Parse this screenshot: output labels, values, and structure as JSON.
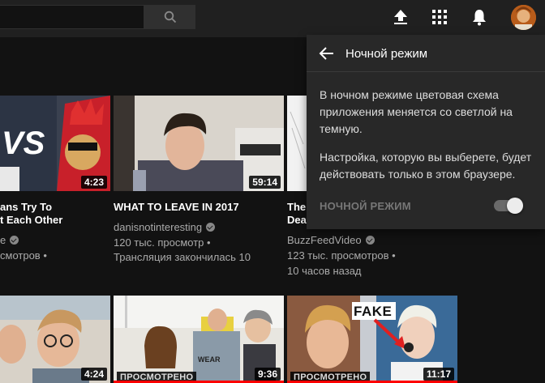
{
  "topbar": {
    "search_placeholder": "",
    "icons": [
      "search-icon",
      "upload-icon",
      "apps-icon",
      "notifications-icon",
      "avatar"
    ]
  },
  "videos": [
    {
      "title_line1": "ans Try To",
      "title_line2": "t Each Other",
      "channel": "e",
      "verified": true,
      "views": "смотров •",
      "age": "",
      "duration": "4:23"
    },
    {
      "title_line1": "WHAT TO LEAVE IN 2017",
      "title_line2": "",
      "channel": "danisnotinteresting",
      "verified": true,
      "views": "120 тыс. просмотр •",
      "age": "Трансляция закончилась 10",
      "duration": "59:14"
    },
    {
      "title_line1": "The",
      "title_line2": "Dea",
      "channel": "BuzzFeedVideo",
      "verified": true,
      "views": "123 тыс. просмотров •",
      "age": "10 часов назад",
      "duration": ""
    },
    {
      "title_line1": "",
      "title_line2": "",
      "channel": "",
      "verified": false,
      "views": "",
      "age": "",
      "duration": "4:24",
      "watched": ""
    },
    {
      "title_line1": "",
      "title_line2": "",
      "channel": "",
      "verified": false,
      "views": "",
      "age": "",
      "duration": "9:36",
      "watched": "ПРОСМОТРЕНО"
    },
    {
      "title_line1": "",
      "title_line2": "",
      "channel": "",
      "verified": false,
      "views": "",
      "age": "",
      "duration": "11:17",
      "watched": "ПРОСМОТРЕНО",
      "overlay": "FAKE"
    }
  ],
  "popup": {
    "title": "Ночной режим",
    "para1": "В ночном режиме цветовая схема приложения меняется со светлой на темную.",
    "para2": "Настройка, которую вы выберете, будет действовать только в этом браузере.",
    "toggle_label": "НОЧНОЙ РЕЖИМ",
    "toggle_on": true
  },
  "colors": {
    "background": "#121212",
    "topbar": "#202020",
    "popup": "#282828",
    "duration_badge": "#000000",
    "accent_red": "#ff0000"
  }
}
